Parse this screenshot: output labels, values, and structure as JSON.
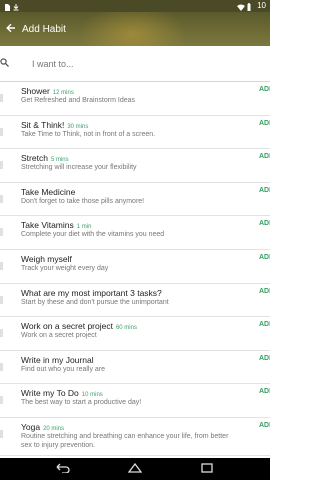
{
  "status_bar": {
    "time": "10",
    "icons": [
      "sd-card-icon",
      "download-icon",
      "wifi-icon",
      "battery-icon"
    ]
  },
  "app_bar": {
    "title": "Add Habit"
  },
  "search": {
    "placeholder": "I want to..."
  },
  "habits": [
    {
      "name": "Shower",
      "duration": "12 mins",
      "desc": "Get Refreshed and Brainstorm Ideas",
      "desc2": "",
      "add": "ADD"
    },
    {
      "name": "Sit & Think!",
      "duration": "30 mins",
      "desc": "Take Time to Think, not in front of a screen.",
      "desc2": "",
      "add": "ADD"
    },
    {
      "name": "Stretch",
      "duration": "5 mins",
      "desc": "Stretching will increase your flexibility",
      "desc2": "",
      "add": "ADD"
    },
    {
      "name": "Take Medicine",
      "duration": "",
      "desc": "Don't forget to take those pills anymore!",
      "desc2": "",
      "add": "ADD"
    },
    {
      "name": "Take Vitamins",
      "duration": "1 min",
      "desc": "Complete your diet with the vitamins you need",
      "desc2": "",
      "add": "ADD"
    },
    {
      "name": "Weigh myself",
      "duration": "",
      "desc": "Track your weight every day",
      "desc2": "",
      "add": "ADD"
    },
    {
      "name": "What are my most important 3 tasks?",
      "duration": "",
      "desc": "Start by these and don't pursue the unimportant",
      "desc2": "",
      "add": "ADD"
    },
    {
      "name": "Work on a secret project",
      "duration": "60 mins",
      "desc": "Work on a secret project",
      "desc2": "",
      "add": "ADD"
    },
    {
      "name": "Write in my Journal",
      "duration": "",
      "desc": "Find out who you really are",
      "desc2": "",
      "add": "ADD"
    },
    {
      "name": "Write my To Do",
      "duration": "10 mins",
      "desc": "The best way to start a productive day!",
      "desc2": "",
      "add": "ADD"
    },
    {
      "name": "Yoga",
      "duration": "20 mins",
      "desc": "Routine stretching and breathing can enhance your life, from better",
      "desc2": "sex to injury prevention.",
      "add": "ADD"
    }
  ],
  "colors": {
    "app_bar": "#6d6a35",
    "accent": "#33a060",
    "duration": "#3aa06a"
  }
}
